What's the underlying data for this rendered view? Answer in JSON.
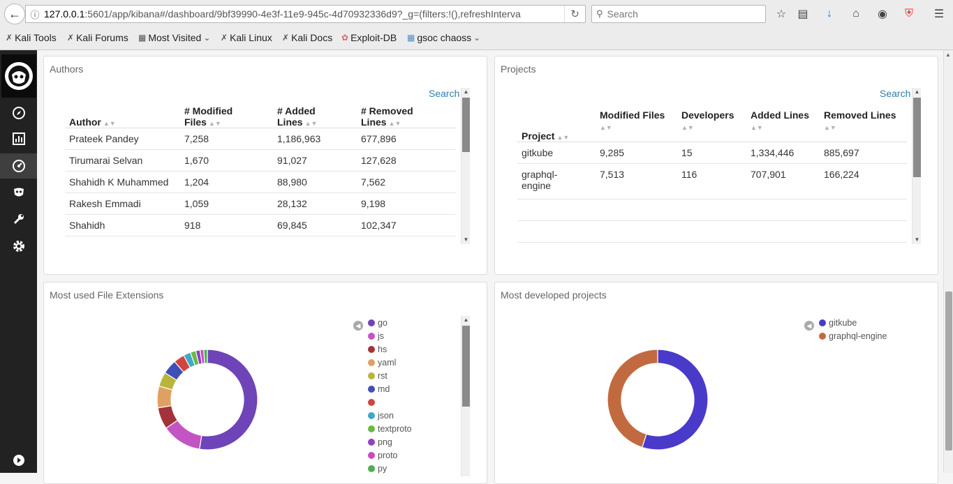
{
  "browser": {
    "url_host": "127.0.0.1",
    "url_rest": ":5601/app/kibana#/dashboard/9bf39990-4e3f-11e9-945c-4d70932336d9?_g=(filters:!(),refreshInterva",
    "search_placeholder": "Search",
    "bookmarks": [
      "Kali Tools",
      "Kali Forums",
      "Most Visited",
      "Kali Linux",
      "Kali Docs",
      "Exploit-DB",
      "gsoc chaoss"
    ]
  },
  "authors_panel": {
    "title": "Authors",
    "search_label": "Search",
    "headers": [
      "Author",
      "# Modified Files",
      "# Added Lines",
      "# Removed Lines"
    ],
    "rows": [
      [
        "Prateek Pandey",
        "7,258",
        "1,186,963",
        "677,896"
      ],
      [
        "Tirumarai Selvan",
        "1,670",
        "91,027",
        "127,628"
      ],
      [
        "Shahidh K Muhammed",
        "1,204",
        "88,980",
        "7,562"
      ],
      [
        "Rakesh Emmadi",
        "1,059",
        "28,132",
        "9,198"
      ],
      [
        "Shahidh",
        "918",
        "69,845",
        "102,347"
      ]
    ]
  },
  "projects_panel": {
    "title": "Projects",
    "search_label": "Search",
    "headers": [
      "Project",
      "Modified Files",
      "Developers",
      "Added Lines",
      "Removed Lines"
    ],
    "rows": [
      [
        "gitkube",
        "9,285",
        "15",
        "1,334,446",
        "885,697"
      ],
      [
        "graphql-engine",
        "7,513",
        "116",
        "707,901",
        "166,224"
      ]
    ]
  },
  "extensions_panel": {
    "title": "Most used File Extensions",
    "legend": [
      {
        "label": "go",
        "color": "#6e44b8"
      },
      {
        "label": "js",
        "color": "#c354c4"
      },
      {
        "label": "hs",
        "color": "#a3333a"
      },
      {
        "label": "yaml",
        "color": "#dfa163"
      },
      {
        "label": "rst",
        "color": "#b9b53b"
      },
      {
        "label": "md",
        "color": "#3f4fb8"
      },
      {
        "label": "",
        "color": "#d2453f"
      },
      {
        "label": "json",
        "color": "#3fa9c5"
      },
      {
        "label": "textproto",
        "color": "#6ab845"
      },
      {
        "label": "png",
        "color": "#8e44c0"
      },
      {
        "label": "proto",
        "color": "#c84cc4"
      },
      {
        "label": "py",
        "color": "#4caf50"
      }
    ]
  },
  "projects_chart_panel": {
    "title": "Most developed projects",
    "legend": [
      {
        "label": "gitkube",
        "color": "#4a3ac9"
      },
      {
        "label": "graphql-engine",
        "color": "#c26a3f"
      }
    ]
  },
  "chart_data": [
    {
      "type": "pie",
      "categories": [
        "go",
        "js",
        "hs",
        "yaml",
        "rst",
        "md",
        "",
        "json",
        "textproto",
        "png",
        "proto",
        "py"
      ],
      "values": [
        45,
        11,
        6,
        6,
        4,
        4,
        3,
        2,
        1.5,
        1.2,
        1,
        1
      ]
    },
    {
      "type": "pie",
      "categories": [
        "gitkube",
        "graphql-engine"
      ],
      "values": [
        55,
        45
      ]
    }
  ]
}
